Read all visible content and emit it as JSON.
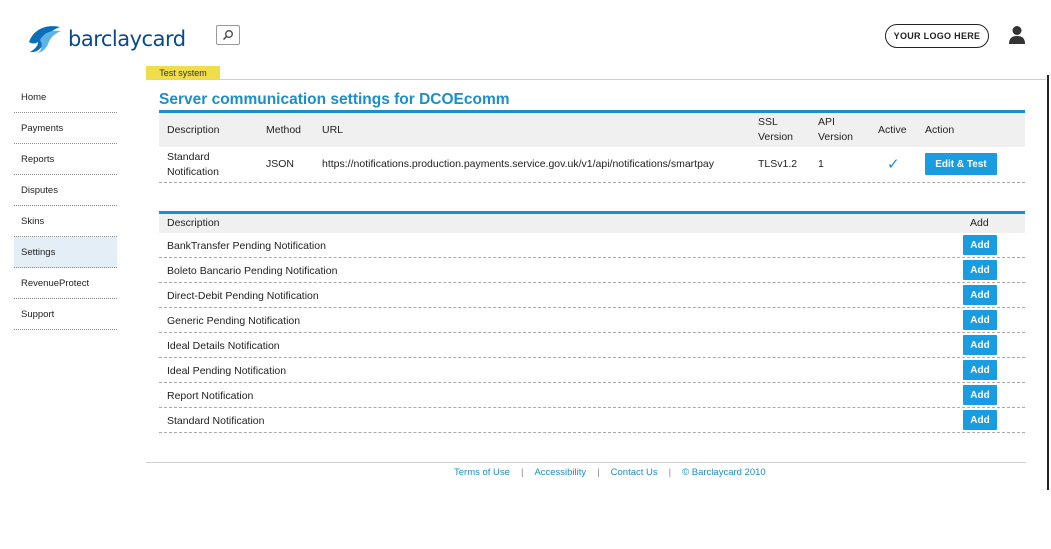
{
  "header": {
    "brand": "barclaycard",
    "your_logo": "YOUR LOGO HERE"
  },
  "sidebar": {
    "items": [
      {
        "label": "Home",
        "active": false
      },
      {
        "label": "Payments",
        "active": false
      },
      {
        "label": "Reports",
        "active": false
      },
      {
        "label": "Disputes",
        "active": false
      },
      {
        "label": "Skins",
        "active": false
      },
      {
        "label": "Settings",
        "active": true
      },
      {
        "label": "RevenueProtect",
        "active": false
      },
      {
        "label": "Support",
        "active": false
      }
    ]
  },
  "main": {
    "badge": "Test system",
    "title": "Server communication settings for DCOEcomm",
    "table1": {
      "headers": {
        "description": "Description",
        "method": "Method",
        "url": "URL",
        "ssl_1": "SSL",
        "ssl_2": "Version",
        "api_1": "API",
        "api_2": "Version",
        "active": "Active",
        "action": "Action"
      },
      "row": {
        "description_1": "Standard",
        "description_2": "Notification",
        "method": "JSON",
        "url": "https://notifications.production.payments.service.gov.uk/v1/api/notifications/smartpay",
        "ssl": "TLSv1.2",
        "api": "1",
        "active_icon": "checkmark-icon",
        "action_label": "Edit & Test"
      }
    },
    "table2": {
      "headers": {
        "description": "Description",
        "add": "Add"
      },
      "rows": [
        {
          "description": "BankTransfer Pending Notification",
          "button": "Add"
        },
        {
          "description": "Boleto Bancario Pending Notification",
          "button": "Add"
        },
        {
          "description": "Direct-Debit Pending Notification",
          "button": "Add"
        },
        {
          "description": "Generic Pending Notification",
          "button": "Add"
        },
        {
          "description": "Ideal Details Notification",
          "button": "Add"
        },
        {
          "description": "Ideal Pending Notification",
          "button": "Add"
        },
        {
          "description": "Report Notification",
          "button": "Add"
        },
        {
          "description": "Standard Notification",
          "button": "Add"
        }
      ]
    }
  },
  "footer": {
    "terms": "Terms of Use",
    "accessibility": "Accessibility",
    "contact": "Contact Us",
    "copyright": "© Barclaycard 2010",
    "separator": "|"
  },
  "colors": {
    "accent": "#1a8fc9",
    "button": "#1a9de0",
    "badge": "#f0dd4a",
    "brand": "#0a4a8c"
  }
}
